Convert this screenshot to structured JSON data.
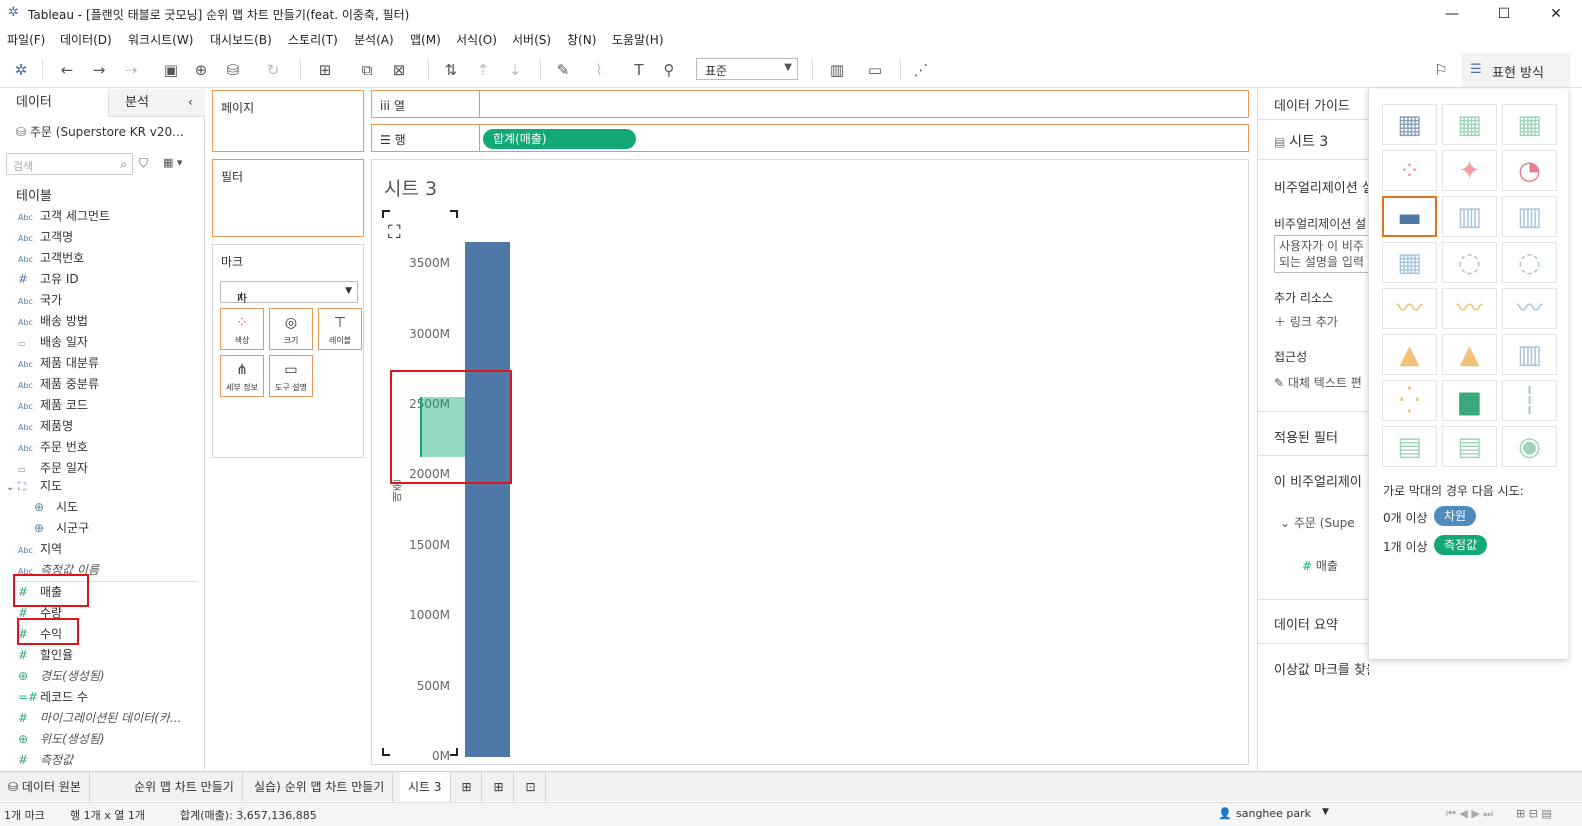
{
  "window": {
    "title": "Tableau - [플랜잇 태블로 굿모닝] 순위 맵 차트 만들기(feat. 이중축, 필터)"
  },
  "menu": [
    "파일(F)",
    "데이터(D)",
    "워크시트(W)",
    "대시보드(B)",
    "스토리(T)",
    "분석(A)",
    "맵(M)",
    "서식(O)",
    "서버(S)",
    "창(N)",
    "도움말(H)"
  ],
  "toolbar": {
    "zoom": "표준",
    "format_label": "표현 방식"
  },
  "datapane": {
    "tab_data": "데이터",
    "tab_analysis": "분석",
    "datasource": "주문 (Superstore KR v20...",
    "search_placeholder": "검색",
    "tables_header": "테이블",
    "fields": [
      {
        "type": "Abc",
        "name": "고객 세그먼트"
      },
      {
        "type": "Abc",
        "name": "고객명"
      },
      {
        "type": "Abc",
        "name": "고객번호"
      },
      {
        "type": "#",
        "name": "고유 ID"
      },
      {
        "type": "Abc",
        "name": "국가"
      },
      {
        "type": "Abc",
        "name": "배송 방법"
      },
      {
        "type": "date",
        "name": "배송 일자"
      },
      {
        "type": "Abc",
        "name": "제품 대분류"
      },
      {
        "type": "Abc",
        "name": "제품 중분류"
      },
      {
        "type": "Abc",
        "name": "제품 코드"
      },
      {
        "type": "Abc",
        "name": "제품명"
      },
      {
        "type": "Abc",
        "name": "주문 번호"
      },
      {
        "type": "date",
        "name": "주문 일자"
      }
    ],
    "geo_group": "지도",
    "geo_children": [
      "시도",
      "시군구"
    ],
    "region": "지역",
    "measure_names": "측정값 이름",
    "measures": [
      {
        "type": "#",
        "name": "매출"
      },
      {
        "type": "#",
        "name": "수량"
      },
      {
        "type": "#",
        "name": "수익"
      },
      {
        "type": "#",
        "name": "할인율"
      },
      {
        "type": "geo",
        "name": "경도(생성됨)"
      },
      {
        "type": "=#",
        "name": "레코드 수"
      },
      {
        "type": "#",
        "name": "마이그레이션된 데이터(카..."
      },
      {
        "type": "geo",
        "name": "위도(생성됨)"
      },
      {
        "type": "#",
        "name": "측정값"
      }
    ]
  },
  "shelves": {
    "pages": "페이지",
    "filters": "필터",
    "marks": "마크",
    "mark_type": "자동",
    "mark_cards": [
      "색상",
      "크기",
      "레이블",
      "세부 정보",
      "도구 설명"
    ],
    "columns": "열",
    "rows": "행",
    "row_pill": "합계(매출)"
  },
  "view": {
    "sheet_title": "시트 3",
    "y_axis_label": "매출",
    "ticks": [
      "3500M",
      "3000M",
      "2500M",
      "2000M",
      "1500M",
      "1000M",
      "500M",
      "0M"
    ]
  },
  "chart_data": {
    "type": "bar",
    "categories": [
      ""
    ],
    "values": [
      3657136885
    ],
    "ylabel": "매출",
    "ylim": [
      0,
      3700000000
    ]
  },
  "guide": {
    "title": "데이터 가이드",
    "sheet": "시트 3",
    "viz_desc_header": "비주얼리제이션 설",
    "viz_desc_label": "비주얼리제이션 설",
    "viz_desc_box_1": "사용자가 이 비주",
    "viz_desc_box_2": "되는 설명을 입력",
    "resources": "추가 리소스",
    "add_link": "링크 추가",
    "accessibility": "접근성",
    "alt_text": "대체 텍스트 편",
    "applied_filters": "적용된 필터",
    "this_viz": "이 비주얼리제이",
    "source": "주문 (Supe",
    "measure": "매출",
    "data_summary": "데이터 요약",
    "outliers": "이상값 마크를 찾을 수 없음"
  },
  "showme": {
    "hint": "가로 막대의 경우 다음 시도:",
    "row1_count": "0개 이상",
    "row1_pill": "차원",
    "row2_count": "1개 이상",
    "row2_pill": "측정값",
    "dim_color": "#4e8bbf",
    "meas_color": "#13a877"
  },
  "tabs": [
    "데이터 원본",
    "순위 맵 차트 만들기",
    "실습) 순위 맵 차트 만들기",
    "시트 3"
  ],
  "status": {
    "marks": "1개 마크",
    "rowcol": "행 1개 x 열 1개",
    "sum": "합계(매출): 3,657,136,885",
    "user": "sanghee park"
  },
  "colors": {
    "accent": "#e4741c",
    "bar": "#4e79a7",
    "pill": "#13a877",
    "highlight": "#e0141e"
  }
}
